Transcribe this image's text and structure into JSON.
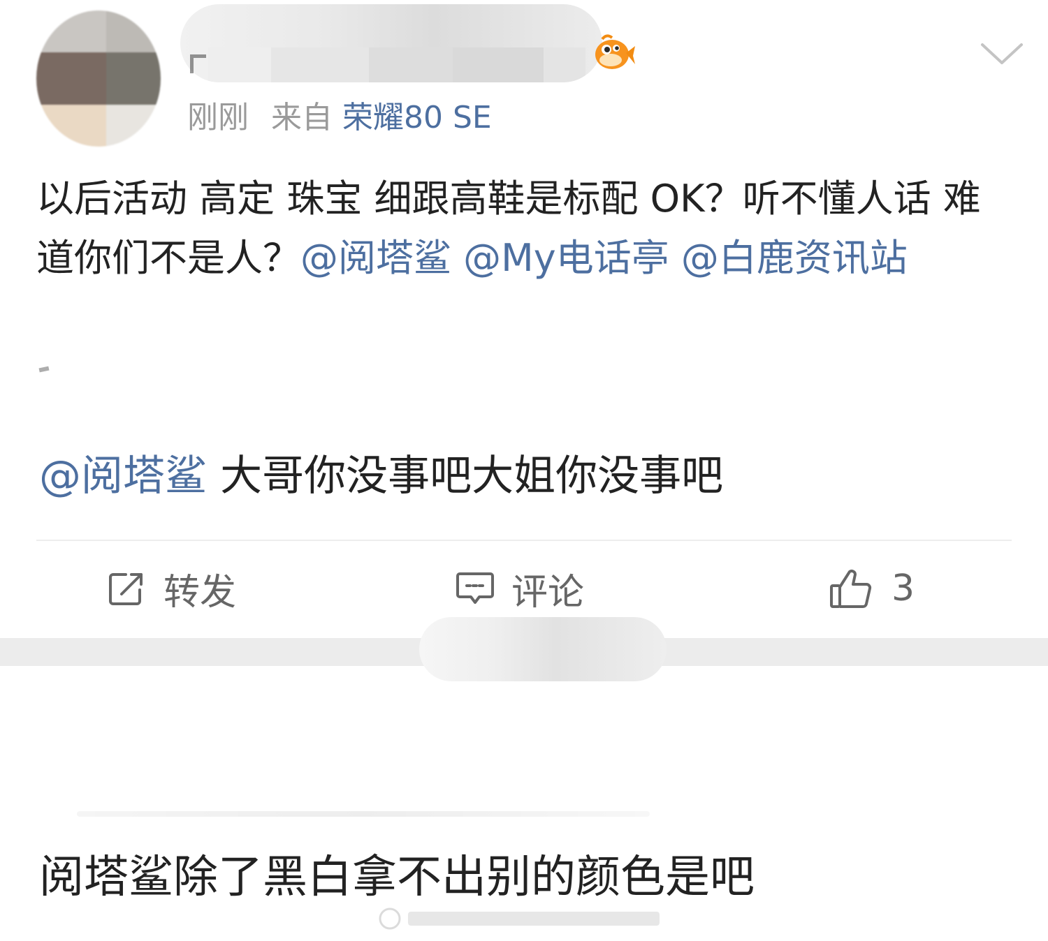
{
  "post": {
    "meta": {
      "time": "刚刚",
      "from_label": "来自",
      "device": "荣耀80 SE"
    },
    "body": {
      "text_1": "以后活动 高定 珠宝 细跟高鞋是标配 OK？听不懂人话 难道你们不是人？",
      "mention_1": "@阅塔鲨",
      "mention_2": "@My电话亭",
      "mention_3": "@白鹿资讯站"
    },
    "reply": {
      "mention": "@阅塔鲨",
      "text": " 大哥你没事吧大姐你没事吧"
    },
    "actions": {
      "repost_label": "转发",
      "comment_label": "评论",
      "like_count": "3"
    }
  },
  "post2": {
    "text": "阅塔鲨除了黑白拿不出别的颜色是吧"
  },
  "colors": {
    "link": "#4d6fa0",
    "meta": "#9a9a9a",
    "text": "#222222",
    "action": "#666666",
    "badge": "#f7931e"
  },
  "icons": {
    "badge": "vip-fish-icon",
    "collapse": "chevron-down-icon",
    "repost": "repost-icon",
    "comment": "comment-icon",
    "like": "thumbs-up-icon"
  }
}
